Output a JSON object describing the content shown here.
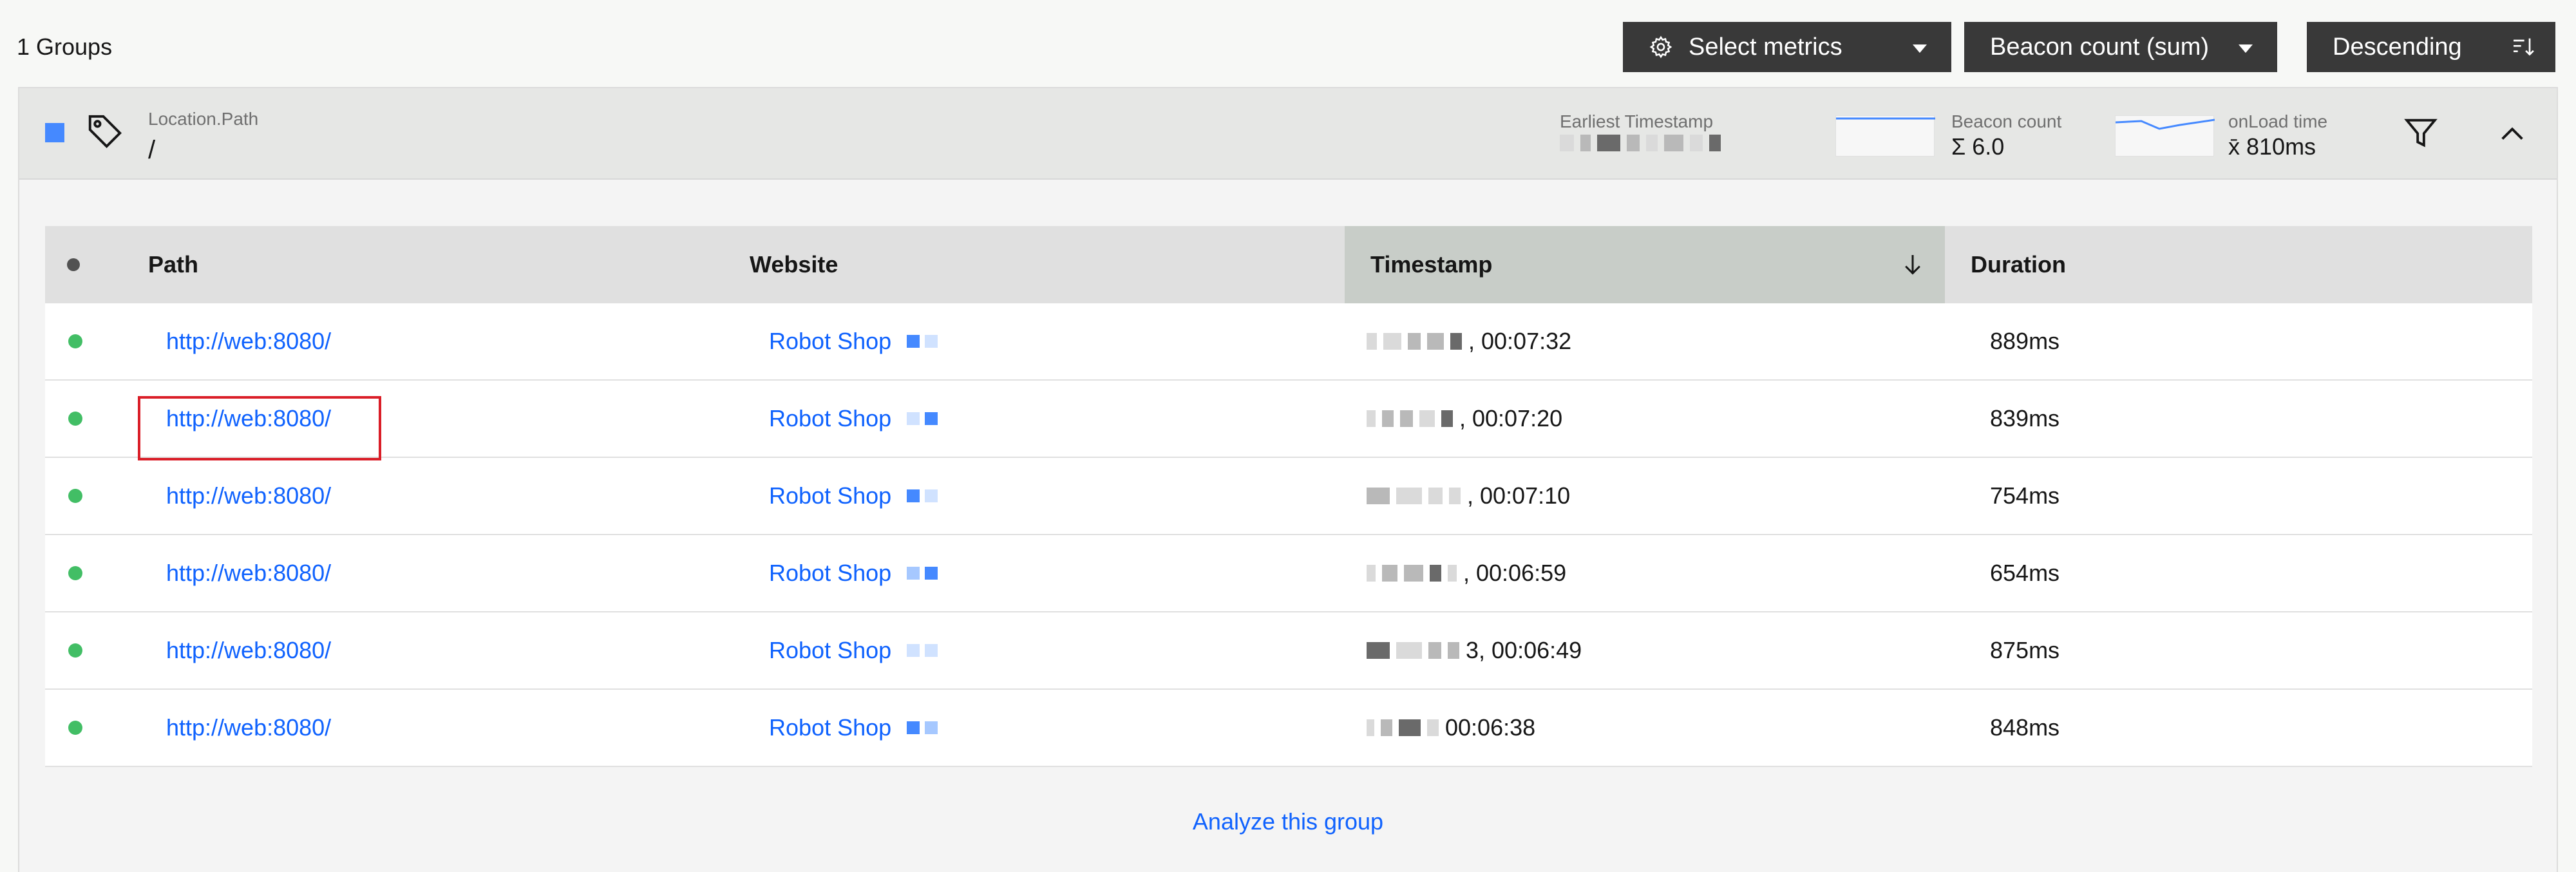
{
  "toolbar": {
    "groups_count": "1 Groups",
    "select_metrics_label": "Select metrics",
    "beacon_count_label": "Beacon count (sum)",
    "sort_order_label": "Descending",
    "icons": [
      "gear-icon",
      "caret-down-icon",
      "sort-icon"
    ]
  },
  "group": {
    "color": "#4589ff",
    "location_label": "Location.Path",
    "location_value": "/",
    "earliest_timestamp_label": "Earliest Timestamp",
    "beacon_count_label": "Beacon count",
    "beacon_count_value": "Σ 6.0",
    "onload_label": "onLoad time",
    "onload_value": "x̄ 810ms",
    "icons": [
      "tag-icon",
      "filter-icon",
      "chevron-up-icon"
    ]
  },
  "table": {
    "columns": [
      "Path",
      "Website",
      "Timestamp",
      "Duration"
    ],
    "sorted_column": "Timestamp",
    "sort_direction": "descending",
    "rows": [
      {
        "path": "http://web:8080/",
        "website": "Robot Shop",
        "time": ", 00:07:32",
        "duration": "889ms"
      },
      {
        "path": "http://web:8080/",
        "website": "Robot Shop",
        "time": ", 00:07:20",
        "duration": "839ms"
      },
      {
        "path": "http://web:8080/",
        "website": "Robot Shop",
        "time": ", 00:07:10",
        "duration": "754ms"
      },
      {
        "path": "http://web:8080/",
        "website": "Robot Shop",
        "time": ", 00:06:59",
        "duration": "654ms"
      },
      {
        "path": "http://web:8080/",
        "website": "Robot Shop",
        "time": "3, 00:06:49",
        "duration": "875ms"
      },
      {
        "path": "http://web:8080/",
        "website": "Robot Shop",
        "time": "00:06:38",
        "duration": "848ms"
      }
    ]
  },
  "analyze_link": "Analyze this group",
  "colors": {
    "accent": "#0f62fe",
    "status_ok": "#42be65",
    "toolbar_bg": "#393939",
    "highlight": "#da1e28"
  }
}
